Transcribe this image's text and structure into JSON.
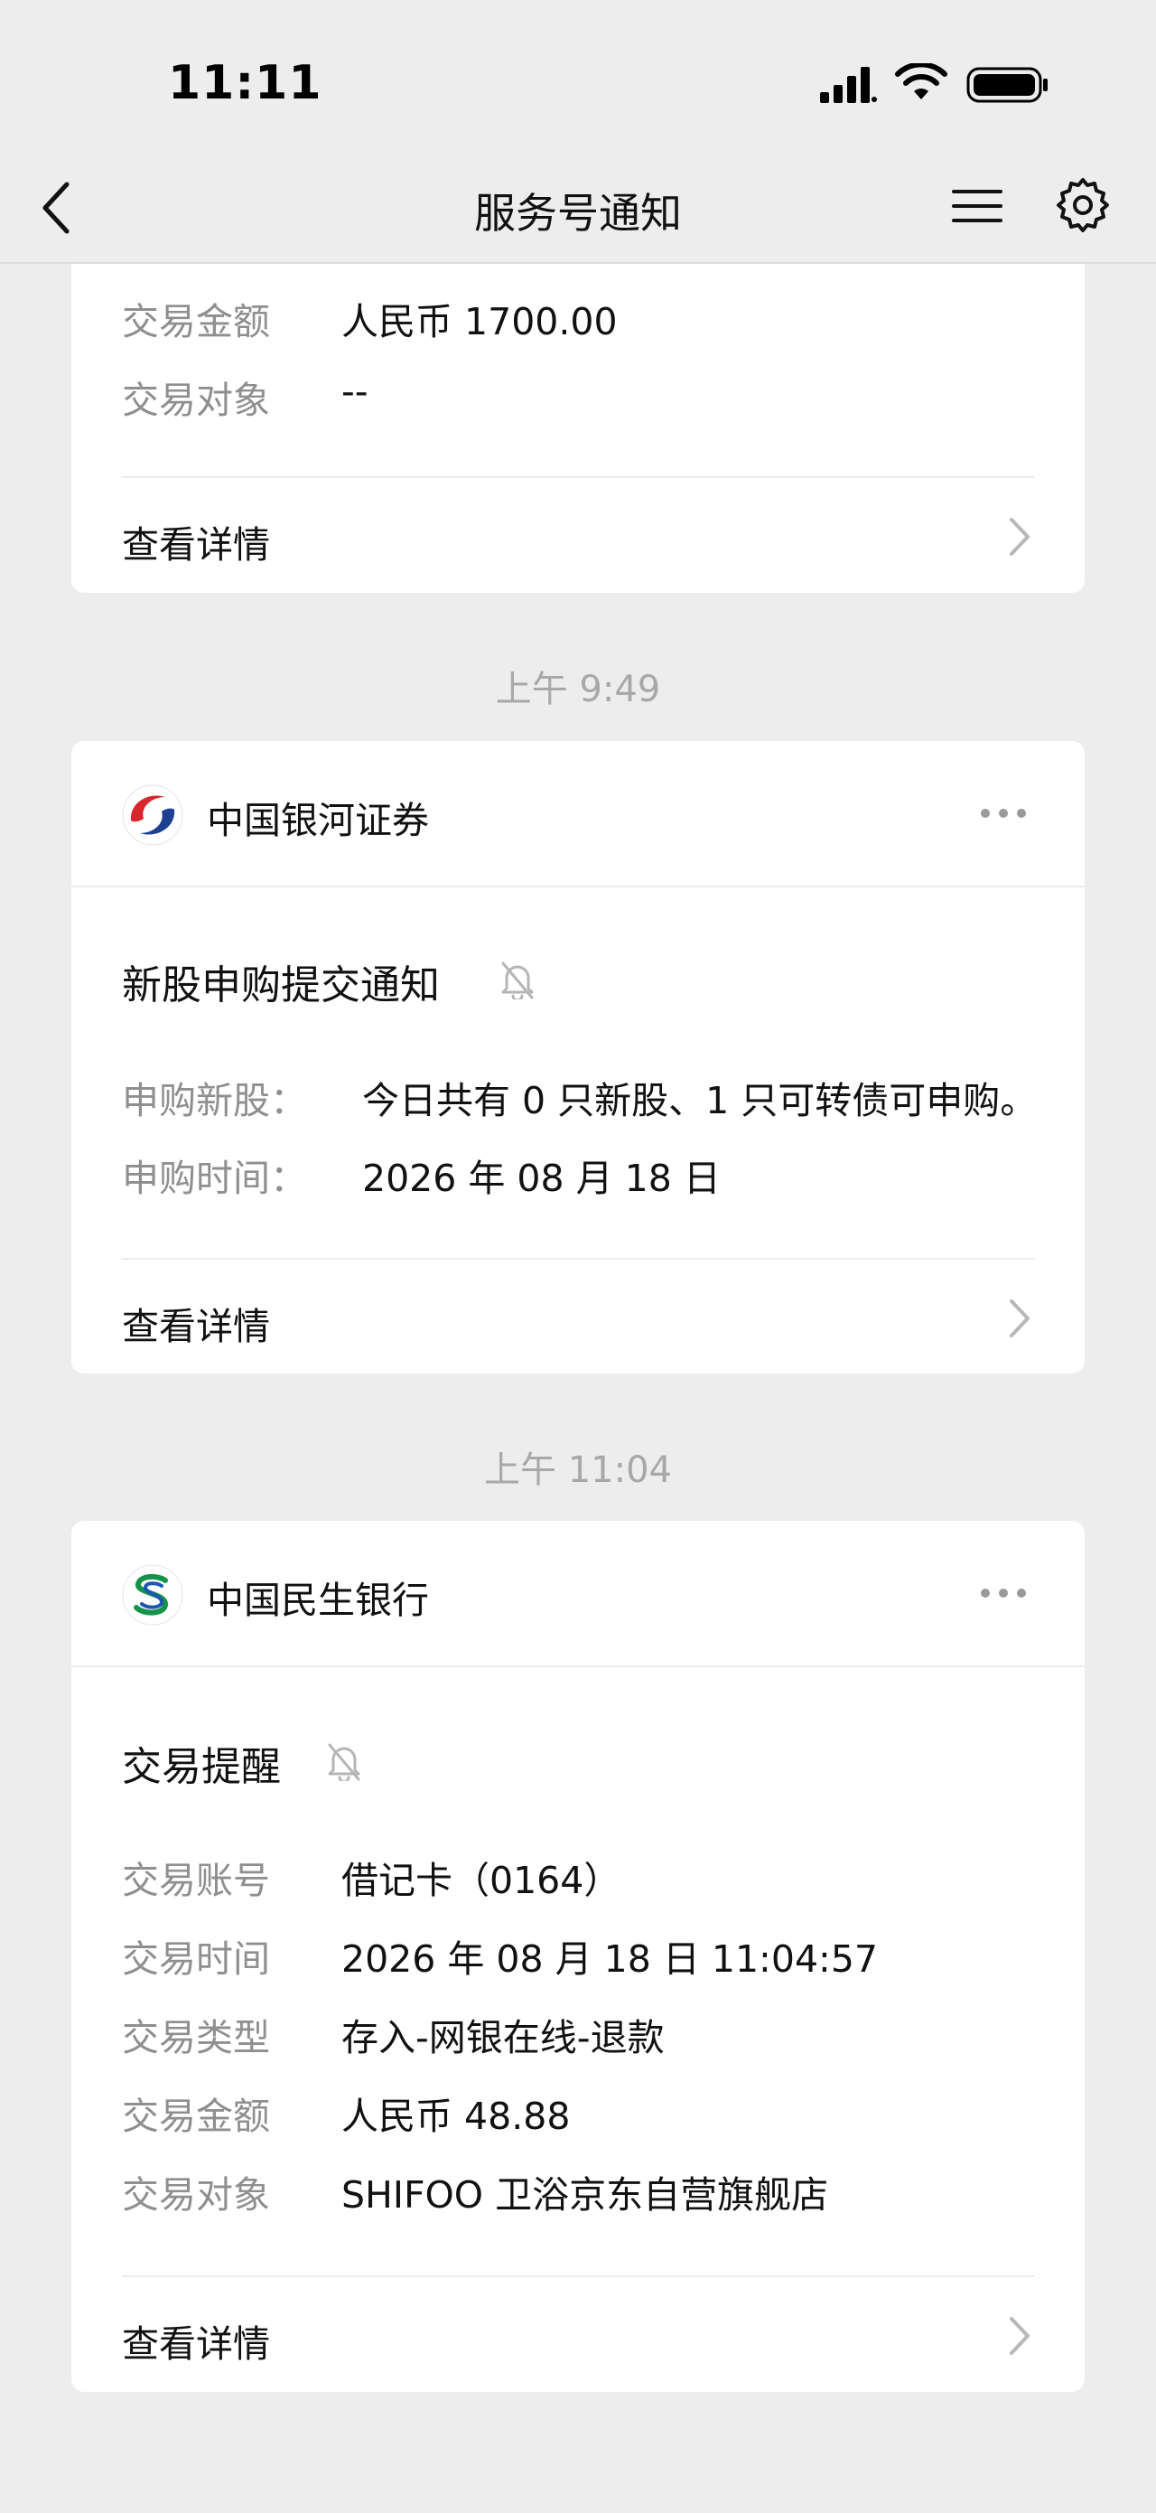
{
  "status_bar": {
    "time": "11:11",
    "signal_icon": "signal-icon",
    "wifi_icon": "wifi-icon",
    "battery_icon": "battery-icon"
  },
  "nav": {
    "title": "服务号通知",
    "back_icon": "chevron-left-icon",
    "menu_icon": "menu-icon",
    "settings_icon": "gear-icon"
  },
  "messages": [
    {
      "partial": true,
      "fields": [
        {
          "label": "交易金额",
          "value": "人民币 1700.00"
        },
        {
          "label": "交易对象",
          "value": "--"
        }
      ],
      "detail_label": "查看详情"
    },
    {
      "timestamp": "上午 9:49",
      "brand": "中国银河证券",
      "title": "新股申购提交通知",
      "fields": [
        {
          "label": "申购新股：",
          "value": "今日共有 0 只新股、1 只可转债可申购。"
        },
        {
          "label": "申购时间：",
          "value": "2026 年 08 月 18 日"
        }
      ],
      "detail_label": "查看详情"
    },
    {
      "timestamp": "上午 11:04",
      "brand": "中国民生银行",
      "title": "交易提醒",
      "fields": [
        {
          "label": "交易账号",
          "value": "借记卡（0164）"
        },
        {
          "label": "交易时间",
          "value": "2026 年 08 月 18 日 11:04:57"
        },
        {
          "label": "交易类型",
          "value": "存入-网银在线-退款"
        },
        {
          "label": "交易金额",
          "value": "人民币 48.88"
        },
        {
          "label": "交易对象",
          "value": "SHIFOO 卫浴京东自营旗舰店"
        }
      ],
      "detail_label": "查看详情"
    }
  ],
  "colors": {
    "background": "#ededed",
    "card": "#ffffff",
    "label_gray": "#8f8f8f",
    "galaxy_red": "#d7262c",
    "galaxy_blue": "#1f3f93",
    "minsheng_green": "#17924a",
    "minsheng_blue": "#1c56b0"
  }
}
